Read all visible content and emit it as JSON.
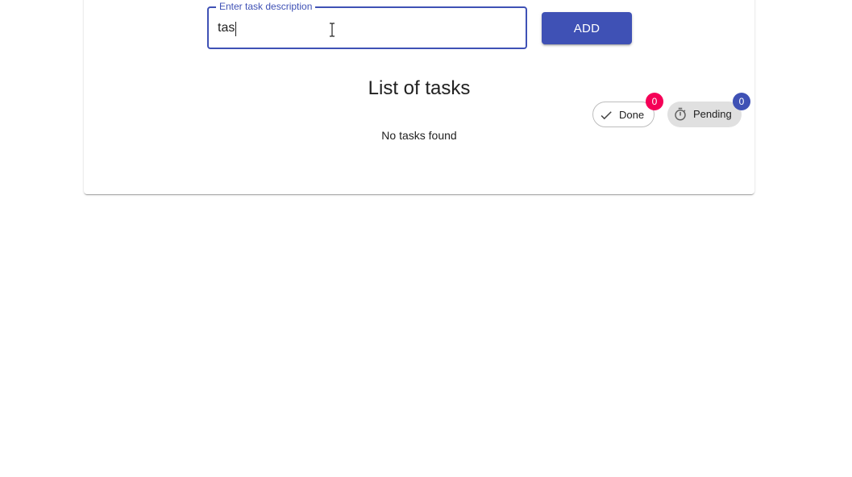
{
  "task_form": {
    "field_label": "Enter task description",
    "input_value": "tas",
    "add_label": "ADD"
  },
  "task_list": {
    "title": "List of tasks",
    "empty_message": "No tasks found"
  },
  "filters": {
    "done": {
      "label": "Done",
      "count": "0",
      "icon": "check-icon",
      "badge_color": "#f50057"
    },
    "pending": {
      "label": "Pending",
      "count": "0",
      "icon": "timer-icon",
      "badge_color": "#3f51b5"
    }
  },
  "colors": {
    "primary": "#3f51b5",
    "secondary": "#f50057"
  }
}
